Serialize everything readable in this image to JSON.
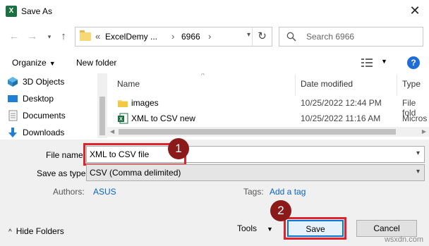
{
  "window": {
    "title": "Save As",
    "app_icon_glyph": "X"
  },
  "address": {
    "crumb_prefix": "«",
    "crumbs": [
      "ExcelDemy ...",
      "6966"
    ],
    "refresh_glyph": "↻"
  },
  "search": {
    "placeholder": "Search 6966"
  },
  "toolbar": {
    "organize": "Organize",
    "new_folder": "New folder",
    "help": "?"
  },
  "nav_pane": {
    "items": [
      {
        "label": "3D Objects",
        "icon": "3d-objects-icon"
      },
      {
        "label": "Desktop",
        "icon": "desktop-icon"
      },
      {
        "label": "Documents",
        "icon": "documents-icon"
      },
      {
        "label": "Downloads",
        "icon": "downloads-icon"
      }
    ]
  },
  "file_list": {
    "columns": [
      "Name",
      "Date modified",
      "Type"
    ],
    "rows": [
      {
        "name": "images",
        "date": "10/25/2022 12:44 PM",
        "type": "File fold",
        "icon": "folder-icon"
      },
      {
        "name": "XML to CSV new",
        "date": "10/25/2022 11:16 AM",
        "type": "Micros",
        "icon": "excel-file-icon"
      }
    ]
  },
  "form": {
    "file_name_label": "File name:",
    "file_name_value": "XML to CSV file",
    "save_type_label": "Save as type:",
    "save_type_value": "CSV (Comma delimited)",
    "authors_label": "Authors:",
    "authors_value": "ASUS",
    "tags_label": "Tags:",
    "tags_value": "Add a tag"
  },
  "footer": {
    "hide_folders": "Hide Folders",
    "tools": "Tools",
    "save": "Save",
    "cancel": "Cancel"
  },
  "annotations": {
    "step1": "1",
    "step2": "2"
  },
  "watermark": "wsxdn.com",
  "colors": {
    "highlight_red": "#e0242c",
    "badge": "#8b1a1a",
    "link": "#0a63c5",
    "accent": "#0078d7"
  }
}
